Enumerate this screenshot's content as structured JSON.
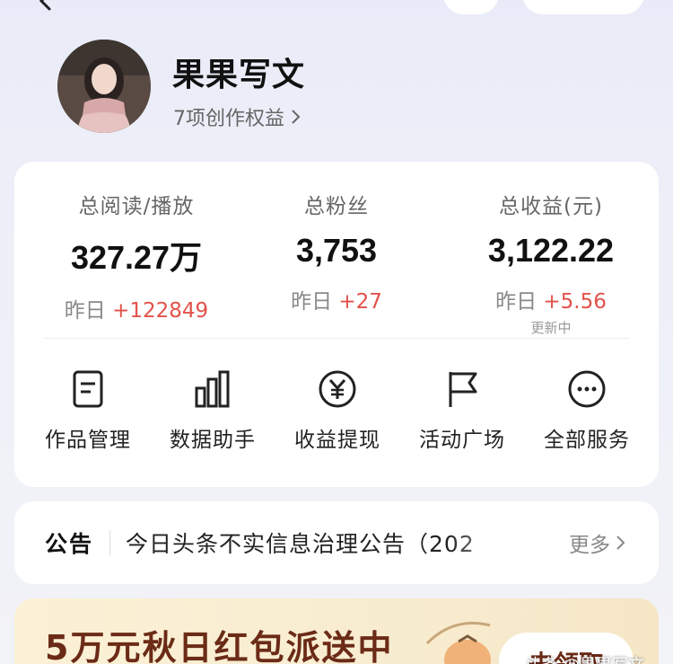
{
  "profile": {
    "name": "果果写文",
    "benefits": "7项创作权益"
  },
  "stats": [
    {
      "label": "总阅读/播放",
      "value": "327.27万",
      "delta_prefix": "昨日",
      "delta": "+122849",
      "sub": ""
    },
    {
      "label": "总粉丝",
      "value": "3,753",
      "delta_prefix": "昨日",
      "delta": "+27",
      "sub": ""
    },
    {
      "label": "总收益(元)",
      "value": "3,122.22",
      "delta_prefix": "昨日",
      "delta": "+5.56",
      "sub": "更新中"
    }
  ],
  "actions": [
    {
      "label": "作品管理",
      "icon": "document-icon"
    },
    {
      "label": "数据助手",
      "icon": "bar-chart-icon"
    },
    {
      "label": "收益提现",
      "icon": "yuan-icon"
    },
    {
      "label": "活动广场",
      "icon": "flag-icon"
    },
    {
      "label": "全部服务",
      "icon": "more-icon"
    }
  ],
  "notice": {
    "label": "公告",
    "text": "今日头条不实信息治理公告（202",
    "more": "更多"
  },
  "promo": {
    "title": "5万元秋日红包派送中",
    "button": "去领取"
  },
  "watermark": "头条 @果果写文",
  "colors": {
    "accent_red": "#e2524a",
    "promo_brown": "#6b2b16"
  }
}
